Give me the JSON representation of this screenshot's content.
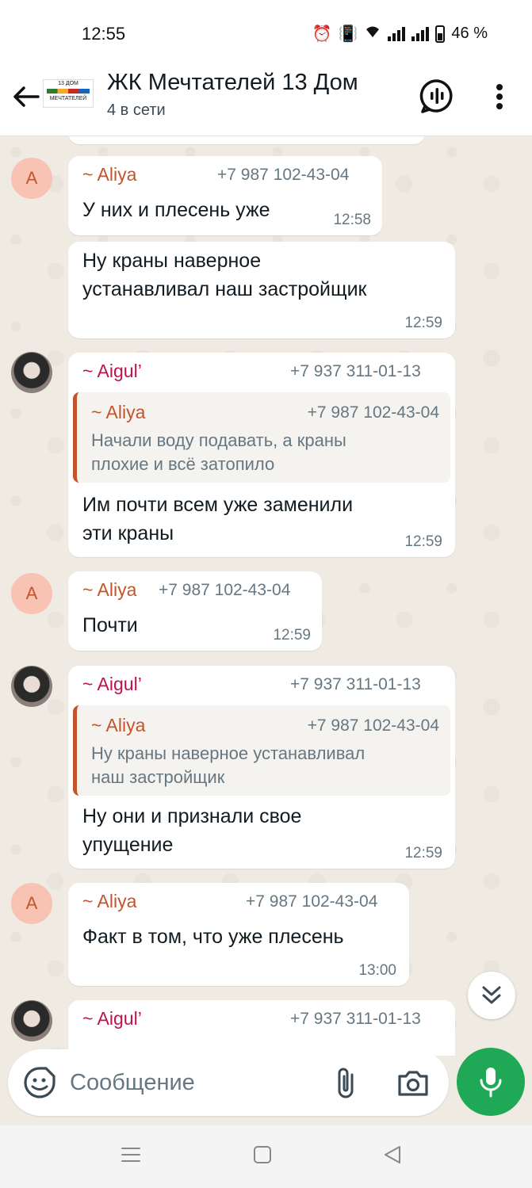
{
  "status_bar": {
    "time": "12:55",
    "battery": "46 %"
  },
  "header": {
    "title": "ЖК Мечтателей 13 Дом",
    "subtitle": "4 в сети",
    "logo_text": "13 ДОМ",
    "logo_caption": "МЕЧТАТЕЛЕЙ"
  },
  "messages": [
    {
      "sender": "~ Aliya",
      "phone": "+7 987 102-43-04",
      "avatar": "A",
      "text": "У них и плесень уже",
      "time": "12:58"
    },
    {
      "text_lines": [
        "Ну краны наверное",
        "устанавливал наш застройщик"
      ],
      "time": "12:59"
    },
    {
      "sender": "~ Aigul’",
      "phone": "+7 937 311-01-13",
      "quote": {
        "sender": "~ Aliya",
        "phone": "+7 987 102-43-04",
        "text_lines": [
          "Начали воду подавать, а краны",
          "плохие и всё затопило"
        ]
      },
      "text_lines": [
        "Им почти всем уже заменили",
        "эти краны"
      ],
      "time": "12:59"
    },
    {
      "sender": "~ Aliya",
      "phone": "+7 987 102-43-04",
      "avatar": "A",
      "text": "Почти",
      "time": "12:59"
    },
    {
      "sender": "~ Aigul’",
      "phone": "+7 937 311-01-13",
      "quote": {
        "sender": "~ Aliya",
        "phone": "+7 987 102-43-04",
        "text_lines": [
          "Ну краны наверное устанавливал",
          "наш застройщик"
        ]
      },
      "text_lines": [
        "Ну они и признали свое",
        "упущение"
      ],
      "time": "12:59"
    },
    {
      "sender": "~ Aliya",
      "phone": "+7 987 102-43-04",
      "avatar": "A",
      "text": "Факт в том, что уже плесень",
      "time": "13:00"
    },
    {
      "sender": "~ Aigul’",
      "phone": "+7 937 311-01-13"
    }
  ],
  "composer": {
    "placeholder": "Сообщение"
  },
  "colors": {
    "accent_green": "#1fa855",
    "aliya_name": "#c2552b",
    "aigul_name": "#c0134a",
    "chat_bg": "#efeae2"
  },
  "icons": [
    "back-arrow-icon",
    "voice-chat-icon",
    "more-vertical-icon",
    "emoji-icon",
    "paperclip-icon",
    "camera-icon",
    "microphone-icon",
    "double-chevron-down-icon"
  ]
}
